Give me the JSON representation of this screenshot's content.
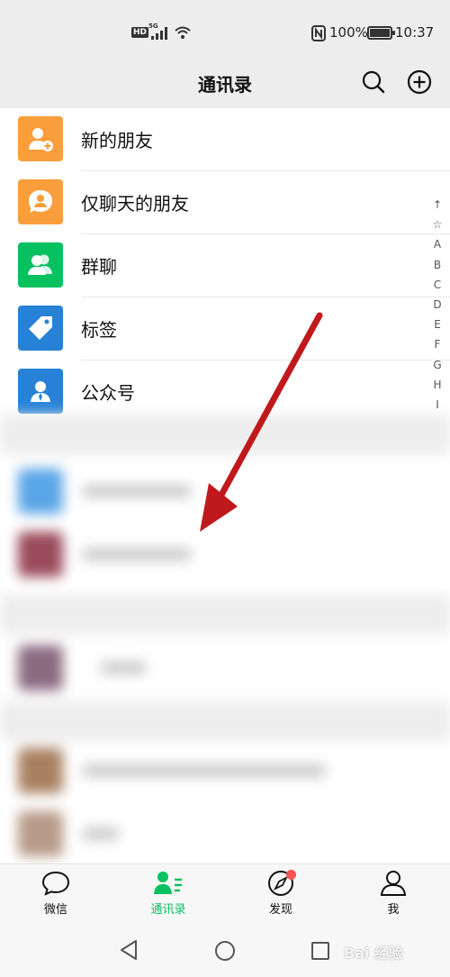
{
  "status_bar": {
    "hd_label": "HD",
    "network_label": "5G",
    "battery_percent": "100%",
    "time": "10:37"
  },
  "header": {
    "title": "通讯录",
    "search_icon": "search-icon",
    "add_icon": "plus-circle-icon"
  },
  "function_rows": [
    {
      "label": "新的朋友",
      "icon": "add-friend-icon",
      "color": "#fa9d3b"
    },
    {
      "label": "仅聊天的朋友",
      "icon": "chat-only-icon",
      "color": "#fa9d3b"
    },
    {
      "label": "群聊",
      "icon": "group-icon",
      "color": "#07c160"
    },
    {
      "label": "标签",
      "icon": "tag-icon",
      "color": "#2782d7"
    },
    {
      "label": "公众号",
      "icon": "official-account-icon",
      "color": "#2782d7"
    }
  ],
  "alphabet_index": [
    "↑",
    "☆",
    "A",
    "B",
    "C",
    "D",
    "E",
    "F",
    "G",
    "H",
    "I"
  ],
  "annotation": {
    "arrow_color": "#c0191d"
  },
  "tab_bar": {
    "active_color": "#07c160",
    "tabs": [
      {
        "label": "微信",
        "icon": "chat-bubble-icon"
      },
      {
        "label": "通讯录",
        "icon": "contacts-icon",
        "active": true
      },
      {
        "label": "发现",
        "icon": "compass-icon",
        "badge_dot": true
      },
      {
        "label": "我",
        "icon": "person-icon"
      }
    ]
  },
  "nav_bar": {
    "watermark": "Bai 经验"
  }
}
